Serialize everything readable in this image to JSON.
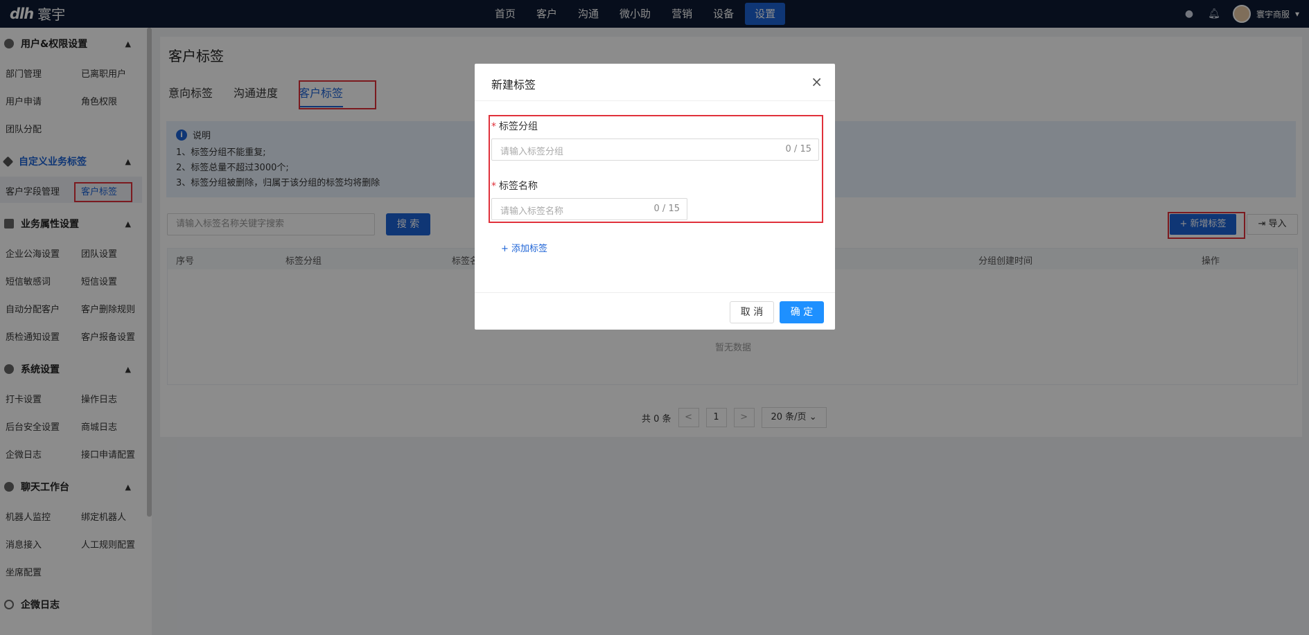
{
  "topbar": {
    "logo_text": "寰宇",
    "logo_mark": "dlh",
    "nav": [
      "首页",
      "客户",
      "沟通",
      "微小助",
      "营销",
      "设备",
      "设置"
    ],
    "active_nav": "设置",
    "username": "寰宇商服"
  },
  "sidebar": {
    "groups": [
      {
        "title": "用户&权限设置",
        "items": [
          "部门管理",
          "已离职用户",
          "用户申请",
          "角色权限",
          "团队分配"
        ]
      },
      {
        "title": "自定义业务标签",
        "items": [
          "客户字段管理",
          "客户标签"
        ]
      },
      {
        "title": "业务属性设置",
        "items": [
          "企业公海设置",
          "团队设置",
          "短信敏感词",
          "短信设置",
          "自动分配客户",
          "客户删除规则",
          "质检通知设置",
          "客户报备设置"
        ]
      },
      {
        "title": "系统设置",
        "items": [
          "打卡设置",
          "操作日志",
          "后台安全设置",
          "商城日志",
          "企微日志",
          "接口申请配置"
        ]
      },
      {
        "title": "聊天工作台",
        "items": [
          "机器人监控",
          "绑定机器人",
          "消息接入",
          "人工规则配置",
          "坐席配置"
        ]
      },
      {
        "title": "企微日志",
        "items": []
      }
    ]
  },
  "main": {
    "title": "客户标签",
    "tabs": [
      "意向标签",
      "沟通进度",
      "客户标签"
    ],
    "info_title": "说明",
    "info_lines": [
      "1、标签分组不能重复;",
      "2、标签总量不超过3000个;",
      "3、标签分组被删除，归属于该分组的标签均将删除"
    ],
    "search_placeholder": "请输入标签名称关键字搜索",
    "search_btn": "搜 索",
    "add_btn": "+ 新增标签",
    "import_btn": "导入",
    "columns": [
      "序号",
      "标签分组",
      "标签名",
      "分组创建时间",
      "操作"
    ],
    "empty": "暂无数据",
    "total": "共 0 条",
    "page": "1",
    "page_size": "20 条/页",
    "prev": "<",
    "next": ">"
  },
  "modal": {
    "title": "新建标签",
    "close": "×",
    "group_label": "标签分组",
    "group_placeholder": "请输入标签分组",
    "group_count": "0 / 15",
    "name_label": "标签名称",
    "name_placeholder": "请输入标签名称",
    "name_count": "0 / 15",
    "add_tag": "添加标签",
    "cancel": "取 消",
    "ok": "确 定"
  }
}
